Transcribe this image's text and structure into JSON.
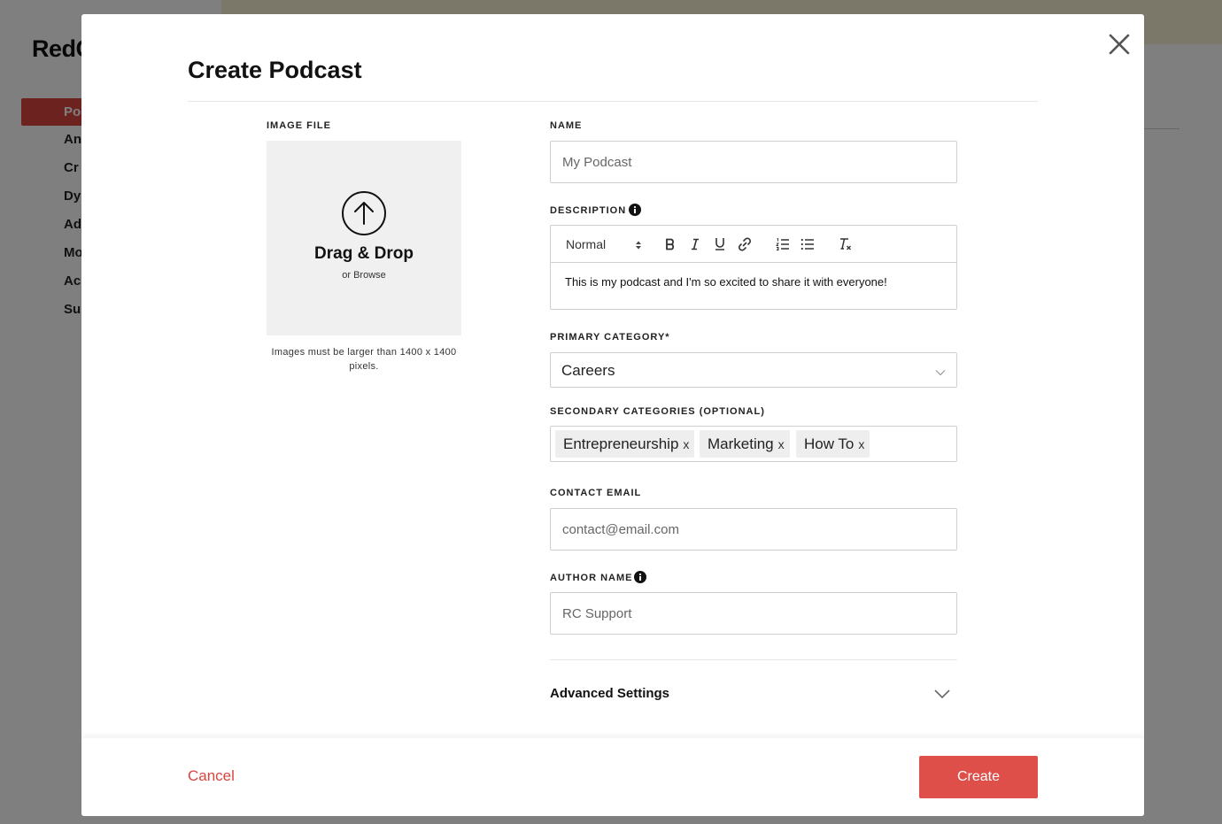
{
  "background": {
    "logo": "RedC",
    "nav_items": [
      "Poc",
      "An",
      "Cr",
      "Dy",
      "Ad",
      "Mo",
      "Ac",
      "Su"
    ]
  },
  "modal": {
    "title": "Create Podcast",
    "image": {
      "label": "IMAGE FILE",
      "drop_title": "Drag & Drop",
      "drop_sub": "or Browse",
      "note": "Images must be larger than 1400 x 1400 pixels."
    },
    "name": {
      "label": "NAME",
      "placeholder": "My Podcast"
    },
    "description": {
      "label": "DESCRIPTION",
      "format": "Normal",
      "text": "This is my podcast and I'm so excited to share it with everyone!"
    },
    "primary_category": {
      "label": "PRIMARY CATEGORY*",
      "value": "Careers"
    },
    "secondary_categories": {
      "label": "SECONDARY CATEGORIES (OPTIONAL)",
      "tags": [
        "Entrepreneurship",
        "Marketing",
        "How To"
      ],
      "remove_symbol": "x"
    },
    "contact_email": {
      "label": "CONTACT EMAIL",
      "placeholder": "contact@email.com"
    },
    "author_name": {
      "label": "AUTHOR NAME",
      "placeholder": "RC Support"
    },
    "advanced": {
      "label": "Advanced Settings"
    },
    "footer": {
      "cancel": "Cancel",
      "create": "Create"
    }
  },
  "colors": {
    "accent": "#df4f4a",
    "cancel_text": "#d9453f",
    "banner": "#f6eed2"
  }
}
